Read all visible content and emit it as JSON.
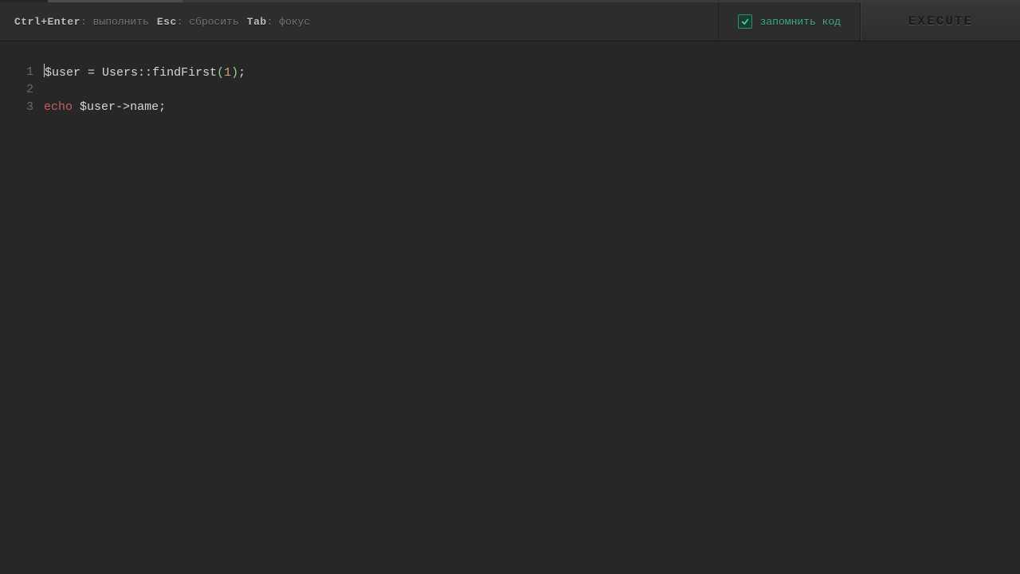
{
  "toolbar": {
    "shortcuts": [
      {
        "key": "Ctrl+Enter",
        "desc": ": выполнить"
      },
      {
        "key": "Esc",
        "desc": ": сбросить"
      },
      {
        "key": "Tab",
        "desc": ": фокус"
      }
    ],
    "remember_label": "запомнить код",
    "remember_checked": true,
    "execute_label": "EXECUTE"
  },
  "editor": {
    "lines": [
      {
        "num": "1",
        "tokens": [
          {
            "cls": "tok-var",
            "t": "$user"
          },
          {
            "cls": "tok-op",
            "t": " = "
          },
          {
            "cls": "tok-class",
            "t": "Users"
          },
          {
            "cls": "tok-op",
            "t": "::"
          },
          {
            "cls": "tok-func",
            "t": "findFirst"
          },
          {
            "cls": "tok-paren",
            "t": "("
          },
          {
            "cls": "tok-num",
            "t": "1"
          },
          {
            "cls": "tok-paren",
            "t": ")"
          },
          {
            "cls": "tok-punc",
            "t": ";"
          }
        ],
        "cursor_before": true
      },
      {
        "num": "2",
        "tokens": []
      },
      {
        "num": "3",
        "tokens": [
          {
            "cls": "tok-kw",
            "t": "echo"
          },
          {
            "cls": "tok-op",
            "t": " "
          },
          {
            "cls": "tok-var",
            "t": "$user"
          },
          {
            "cls": "tok-op",
            "t": "->"
          },
          {
            "cls": "tok-name",
            "t": "name"
          },
          {
            "cls": "tok-punc",
            "t": ";"
          }
        ]
      }
    ]
  }
}
